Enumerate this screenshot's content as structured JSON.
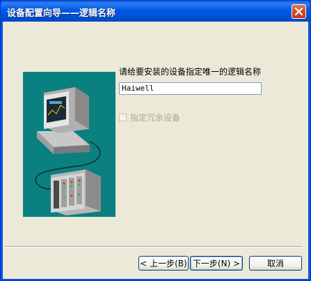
{
  "window": {
    "title": "设备配置向导——逻辑名称"
  },
  "form": {
    "prompt": "请给要安装的设备指定唯一的逻辑名称",
    "name_value": "Haiwell",
    "redundant_label": "指定冗余设备"
  },
  "buttons": {
    "back_label": "< 上一步(B)",
    "next_label": "下一步(N) >",
    "cancel_label": "取消"
  },
  "icons": {
    "close": "close-icon",
    "illustration": "computer-plc-illustration"
  },
  "colors": {
    "title_bar": "#0054e3",
    "dialog_bg": "#ece9d8",
    "illustration_bg": "#0a8080"
  }
}
